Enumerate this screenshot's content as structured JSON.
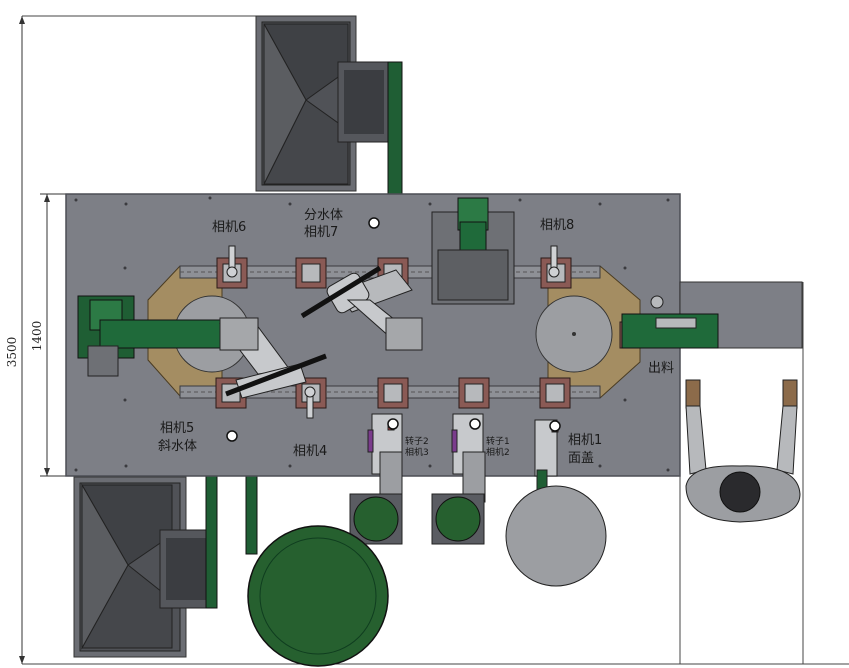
{
  "dimensions": {
    "overall_height": "3500",
    "table_height": "1400"
  },
  "labels": {
    "camera6": "相机6",
    "split_body": "分水体",
    "camera7": "相机7",
    "camera8": "相机8",
    "camera5": "相机5",
    "slant_body": "斜水体",
    "camera4": "相机4",
    "spring2": "转子2",
    "camera3": "相机3",
    "spring1": "转子1",
    "camera2": "相机2",
    "camera1": "相机1",
    "top_cover": "面盖",
    "output": "出料"
  },
  "colors": {
    "table": "#7d7f86",
    "table_edge": "#4d4f55",
    "green": "#1f5e34",
    "tan_track": "#a48d62",
    "fixture": "#8a5a55",
    "hopper": "#5a5c62",
    "bin_fill": "#26602f",
    "disc": "#9c9ea2"
  }
}
